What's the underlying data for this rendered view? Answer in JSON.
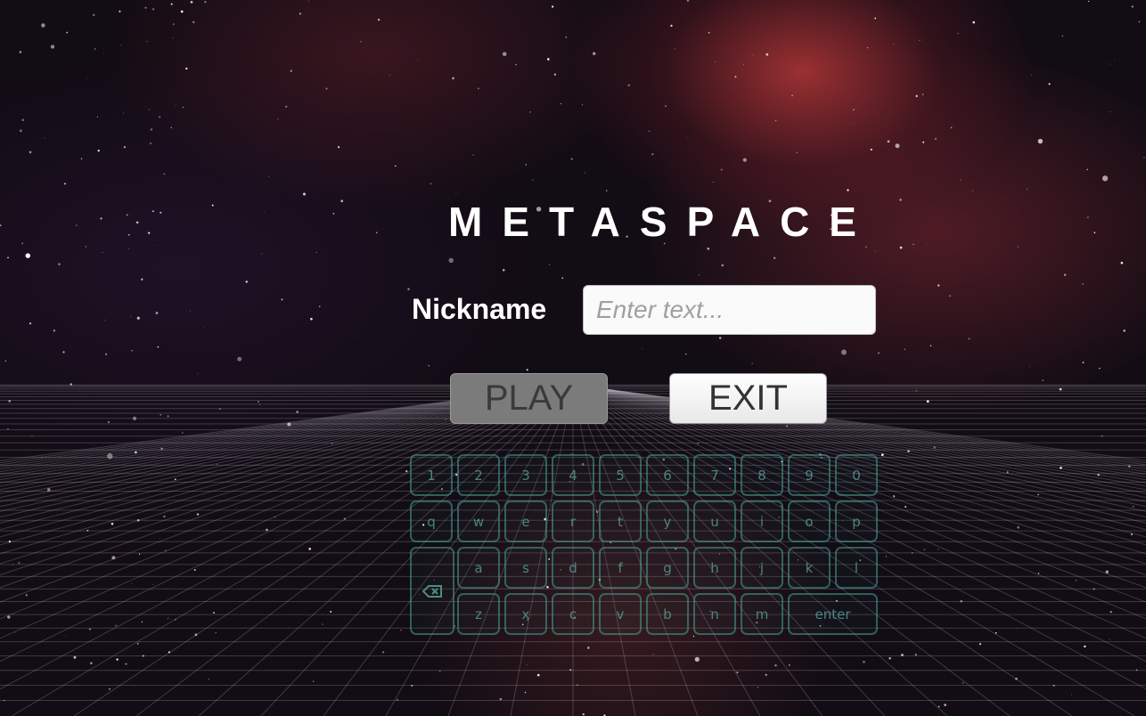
{
  "game": {
    "title": "METASPACE",
    "nickname_label": "Nickname",
    "nickname_placeholder": "Enter text...",
    "play_label": "PLAY",
    "exit_label": "EXIT"
  },
  "keyboard": {
    "row1": [
      "1",
      "2",
      "3",
      "4",
      "5",
      "6",
      "7",
      "8",
      "9",
      "0"
    ],
    "row2": [
      "q",
      "w",
      "e",
      "r",
      "t",
      "y",
      "u",
      "i",
      "o",
      "p"
    ],
    "row3": [
      "a",
      "s",
      "d",
      "f",
      "g",
      "h",
      "j",
      "k",
      "l"
    ],
    "row4": [
      "z",
      "x",
      "c",
      "v",
      "b",
      "n",
      "m"
    ],
    "enter_label": "enter",
    "backspace_icon": "backspace-icon"
  },
  "colors": {
    "key_border": "#46a096",
    "key_text": "#5aaaa0",
    "play_bg": "#7b7b7b",
    "exit_bg": "#f2f2f2"
  }
}
